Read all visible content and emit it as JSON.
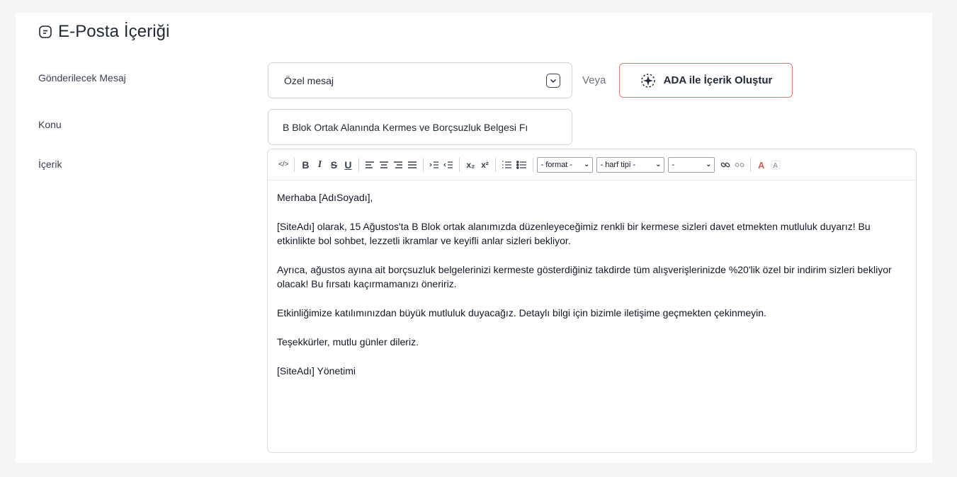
{
  "section": {
    "title": "E-Posta İçeriği",
    "icon": "message-square-icon"
  },
  "fields": {
    "message_label": "Gönderilecek Mesaj",
    "message_value": "Özel mesaj",
    "or_text": "Veya",
    "ada_button_label": "ADA ile İçerik Oluştur",
    "subject_label": "Konu",
    "subject_value": "B Blok Ortak Alanında Kermes ve Borçsuzluk Belgesi Fı",
    "content_label": "İçerik"
  },
  "toolbar": {
    "format_select": "- format -",
    "font_select": "- harf tipi -",
    "size_select": "-",
    "subscript": "x₂",
    "superscript": "x²"
  },
  "editor": {
    "paragraphs": [
      "Merhaba [AdıSoyadı],",
      "[SiteAdı] olarak, 15 Ağustos'ta B Blok ortak alanımızda düzenleyeceğimiz renkli bir kermese sizleri davet etmekten mutluluk duyarız! Bu etkinlikte bol sohbet, lezzetli ikramlar ve keyifli anlar sizleri bekliyor.",
      "Ayrıca, ağustos ayına ait borçsuzluk belgelerinizi kermeste gösterdiğiniz takdirde tüm alışverişlerinizde %20'lik özel bir indirim sizleri bekliyor olacak! Bu fırsatı kaçırmamanızı öneririz.",
      "Etkinliğimize katılımınızdan büyük mutluluk duyacağız. Detaylı bilgi için bizimle iletişime geçmekten çekinmeyin.",
      "Teşekkürler, mutlu günler dileriz.",
      "[SiteAdı] Yönetimi"
    ]
  },
  "colors": {
    "accent_border": "#e07a7a",
    "background": "#f4f4f5"
  }
}
